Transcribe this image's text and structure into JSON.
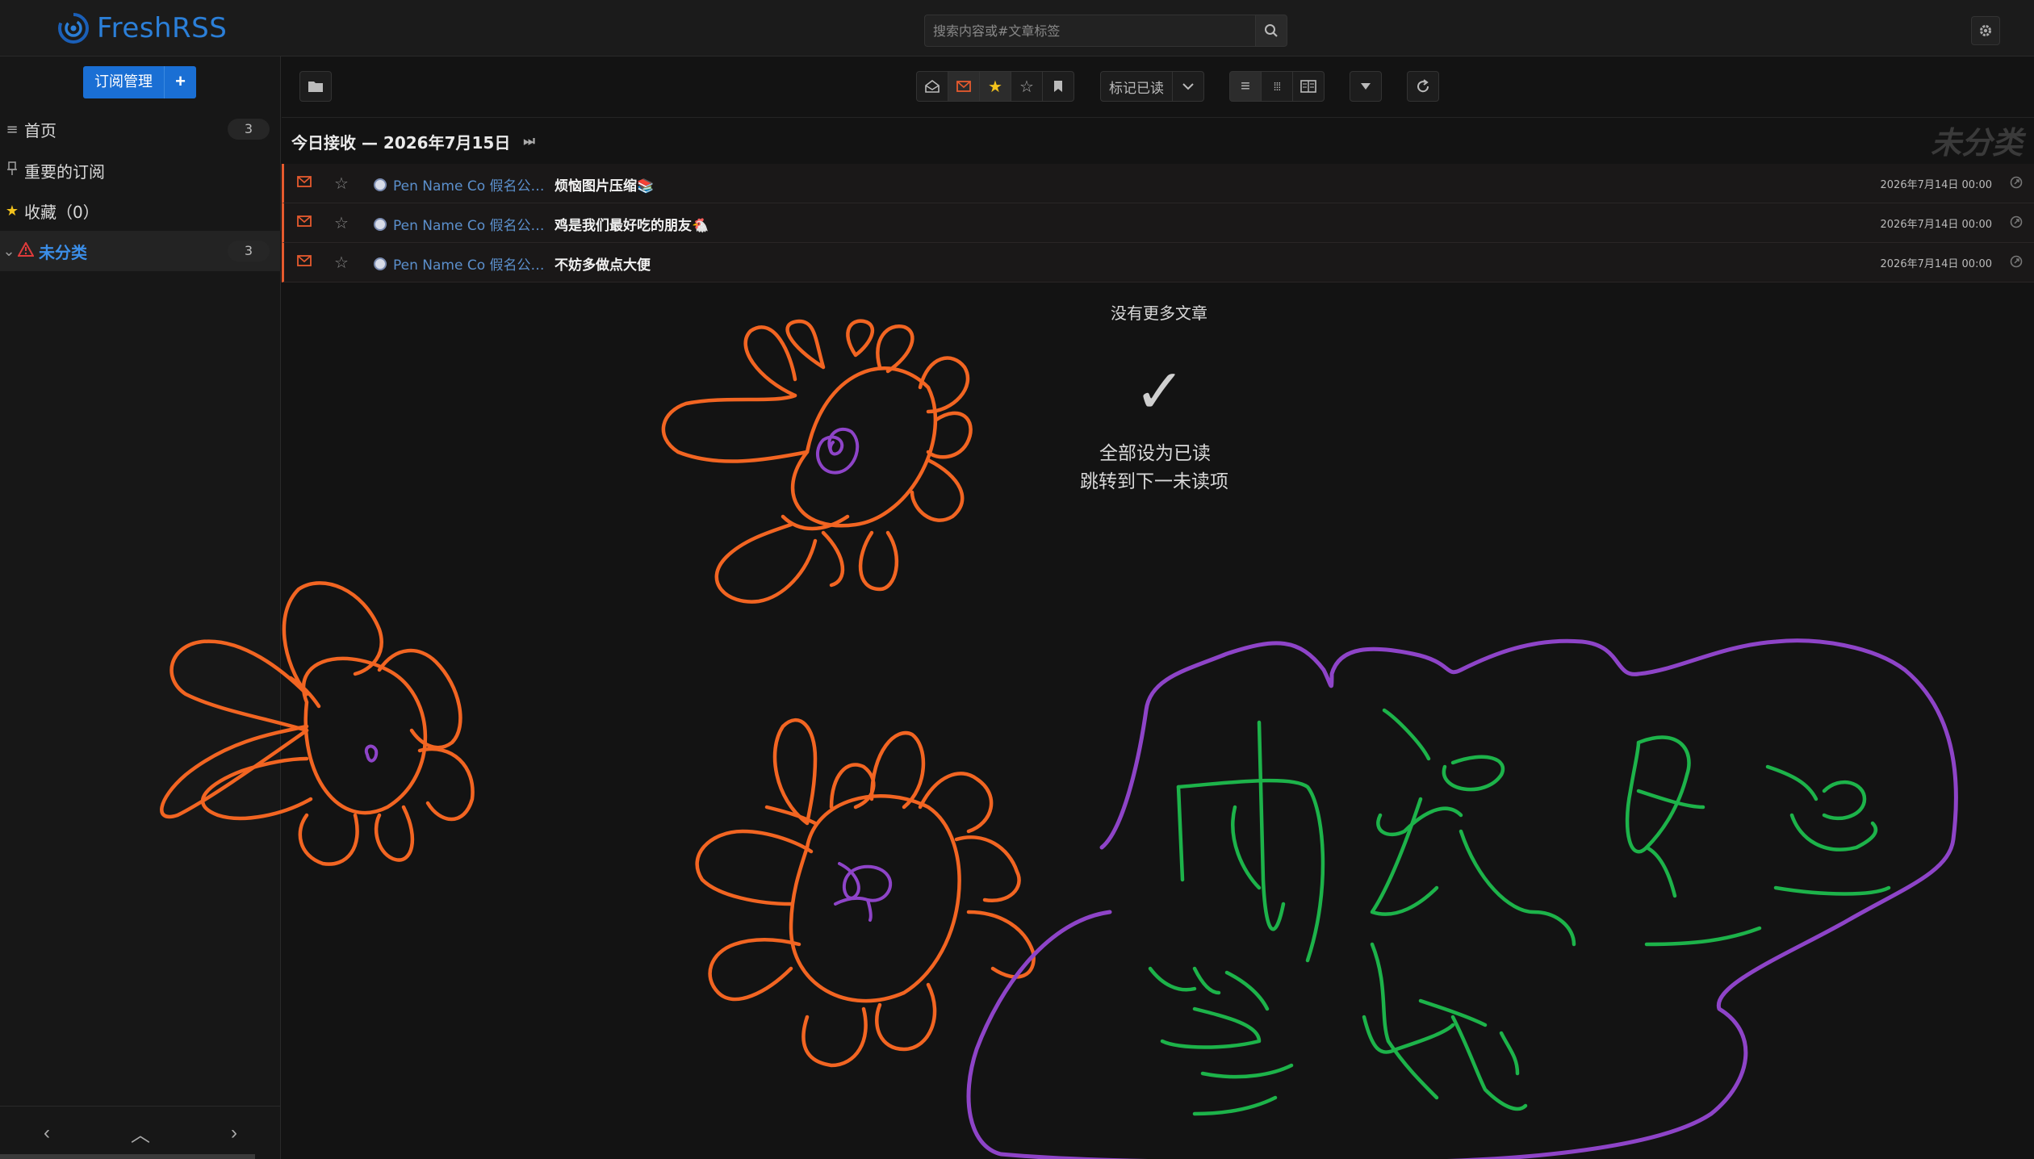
{
  "app": {
    "name": "FreshRSS"
  },
  "search": {
    "placeholder": "搜索内容或#文章标签"
  },
  "sidebar": {
    "subscription_button": "订阅管理",
    "items": [
      {
        "label": "首页",
        "count": "3",
        "icon": "list-icon"
      },
      {
        "label": "重要的订阅",
        "count": "",
        "icon": "pin-icon"
      },
      {
        "label": "收藏（0）",
        "count": "",
        "icon": "star-icon"
      },
      {
        "label": "未分类",
        "count": "3",
        "icon": "warning-icon"
      }
    ]
  },
  "toolbar": {
    "mark_read": "标记已读"
  },
  "day_header": "今日接收 — 2026年7月15日",
  "watermark": "未分类",
  "articles": [
    {
      "feed": "Pen Name Co 假名公…",
      "title": "烦恼图片压缩📚",
      "date": "2026年7月14日 00:00"
    },
    {
      "feed": "Pen Name Co 假名公…",
      "title": "鸡是我们最好吃的朋友🐔",
      "date": "2026年7月14日 00:00"
    },
    {
      "feed": "Pen Name Co 假名公…",
      "title": "不妨多做点大便",
      "date": "2026年7月14日 00:00"
    }
  ],
  "no_more": "没有更多文章",
  "mark_all_read": "全部设为已读",
  "jump_next": "跳转到下一未读项",
  "colors": {
    "accent": "#1a6fd4",
    "unread_border": "#e65a2e",
    "doodle_orange": "#f26522",
    "doodle_green": "#1db34a",
    "doodle_purple": "#8e44c8"
  }
}
